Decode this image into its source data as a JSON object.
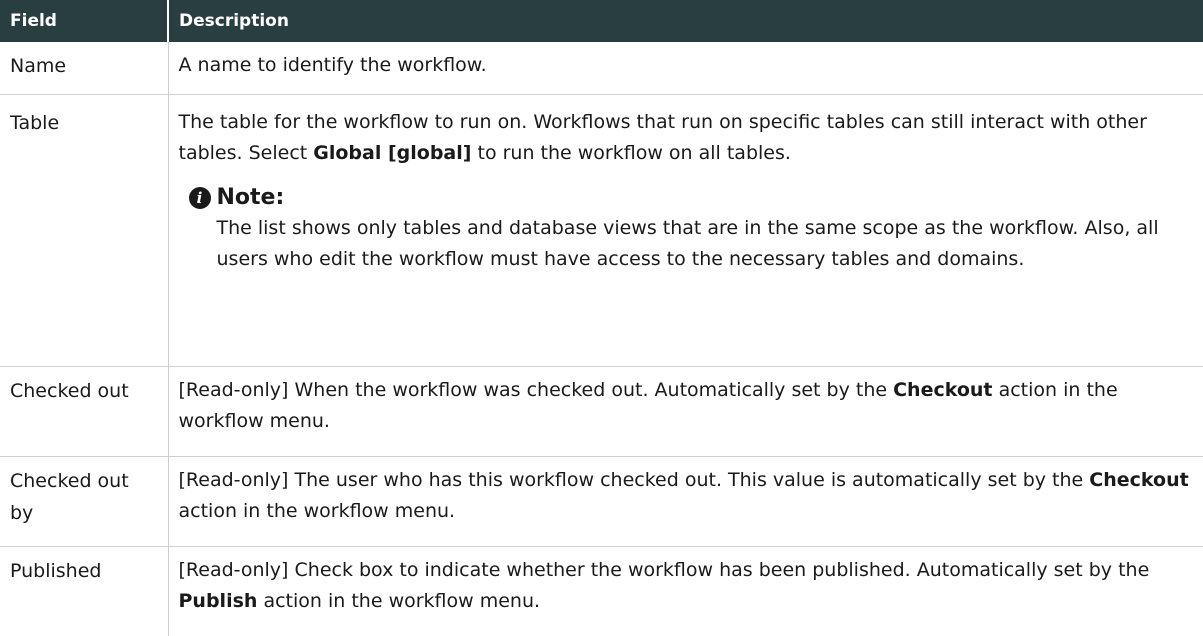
{
  "table": {
    "headers": [
      "Field",
      "Description"
    ],
    "rows": [
      {
        "field": "Name",
        "description": "A name to identify the workflow."
      },
      {
        "field": "Table",
        "desc_part1": "The table for the workflow to run on. Workflows that run on specific tables can still interact with other tables. Select ",
        "desc_bold": "Global [global]",
        "desc_part2": " to run the workflow on all tables.",
        "note_title": "Note:",
        "note_text": "The list shows only tables and database views that are in the same scope as the workflow. Also, all users who edit the workflow must have access to the necessary tables and domains."
      },
      {
        "field": "Checked out",
        "desc_part1": "[Read-only] When the workflow was checked out. Automatically set by the ",
        "desc_bold": "Checkout",
        "desc_part2": " action in the workflow menu."
      },
      {
        "field": "Checked out by",
        "desc_part1": "[Read-only] The user who has this workflow checked out. This value is automatically set by the ",
        "desc_bold": "Checkout",
        "desc_part2": " action in the workflow menu."
      },
      {
        "field": "Published",
        "desc_part1": "[Read-only] Check box to indicate whether the workflow has been published. Automatically set by the ",
        "desc_bold": "Publish",
        "desc_part2": " action in the workflow menu."
      }
    ]
  },
  "icons": {
    "note": "info-icon"
  },
  "colors": {
    "header_bg": "#293e40",
    "header_text": "#ffffff",
    "border": "#cfcfcf"
  }
}
